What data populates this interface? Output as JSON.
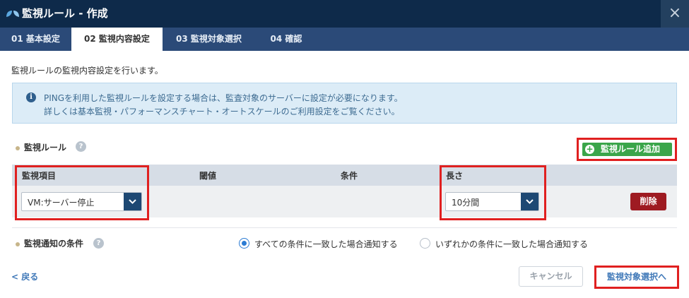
{
  "window": {
    "title": "監視ルール - 作成",
    "close_glyph": "×"
  },
  "tabs": [
    {
      "label": "01 基本設定"
    },
    {
      "label": "02 監視内容設定"
    },
    {
      "label": "03 監視対象選択"
    },
    {
      "label": "04 確認"
    }
  ],
  "intro": "監視ルールの監視内容設定を行います。",
  "info": {
    "line1": "PINGを利用した監視ルールを設定する場合は、監査対象のサーバーに設定が必要になります。",
    "line2": "詳しくは基本監視・パフォーマンスチャート・オートスケールのご利用設定をご覧ください。"
  },
  "rules": {
    "label": "監視ルール",
    "add_button": "監視ルール追加",
    "columns": [
      "監視項目",
      "閾値",
      "条件",
      "長さ"
    ],
    "rows": [
      {
        "item": "VM:サーバー停止",
        "duration": "10分間",
        "delete_label": "削除"
      }
    ]
  },
  "notify": {
    "label": "監視通知の条件",
    "options": [
      {
        "label": "すべての条件に一致した場合通知する",
        "selected": true
      },
      {
        "label": "いずれかの条件に一致した場合通知する",
        "selected": false
      }
    ]
  },
  "footer": {
    "back": "< 戻る",
    "cancel": "キャンセル",
    "next": "監視対象選択へ"
  },
  "colors": {
    "titlebar": "#0e2a4a",
    "tabbar": "#2b4a78",
    "add_button": "#3aa54a",
    "delete_button": "#9e1b22",
    "highlight": "#e02020",
    "link": "#3f78b8"
  }
}
